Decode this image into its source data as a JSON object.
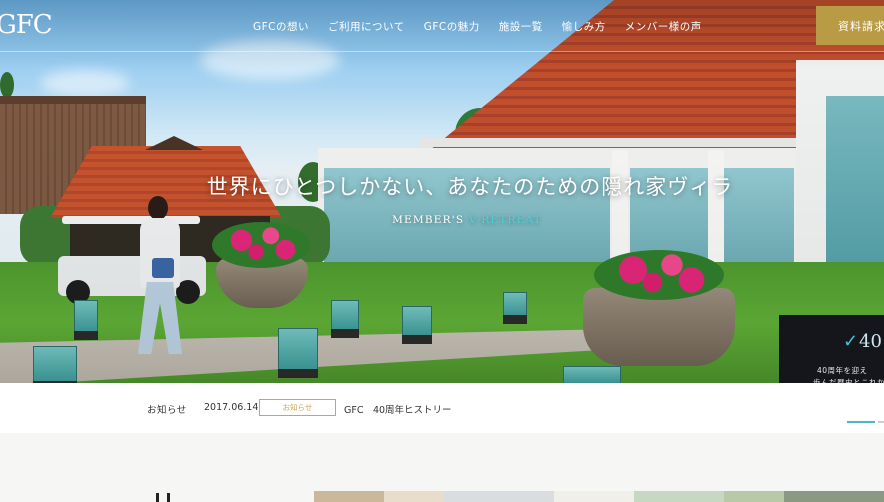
{
  "brand": {
    "logo": "GFC"
  },
  "nav": {
    "items": [
      "GFCの想い",
      "ご利用について",
      "GFCの魅力",
      "施設一覧",
      "愉しみ方",
      "メンバー様の声"
    ],
    "cta_label": "資料請求"
  },
  "hero": {
    "title": "世界にひとつしかない、あなたのための隠れ家ヴィラ",
    "subtitle_a": "MEMBER'S ",
    "subtitle_b": "V-RETREAT"
  },
  "banner": {
    "mark": "40",
    "line1": "40周年を迎え",
    "line2": "歩んだ歴史とこれか"
  },
  "news": {
    "label": "お知らせ",
    "date": "2017.06.14",
    "tag": "お知らせ",
    "text": "GFC　40周年ヒストリー"
  },
  "colors": {
    "accent_gold": "#b99a45",
    "accent_teal": "#4fd0d6",
    "tag_gold": "#c9a55c"
  }
}
